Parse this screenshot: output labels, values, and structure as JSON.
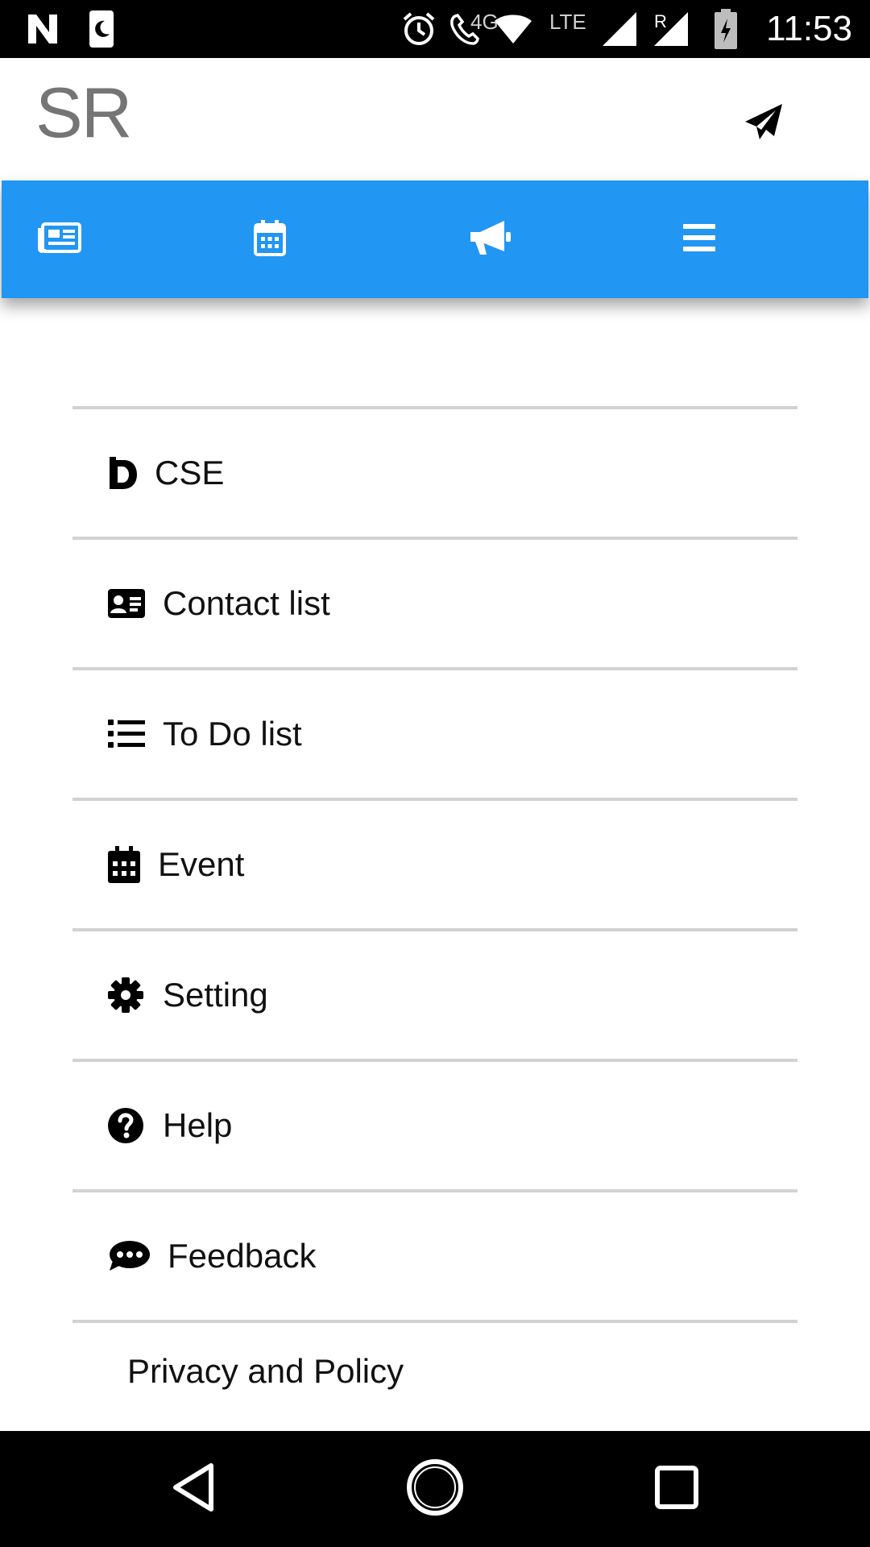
{
  "status_bar": {
    "time": "11:53",
    "network_4g": "4G",
    "network_lte": "LTE",
    "roaming": "R",
    "icons": [
      "notification-n-icon",
      "sim-moon-icon",
      "alarm-icon",
      "call-4g-icon",
      "wifi-icon",
      "signal-icon",
      "signal-roaming-icon",
      "battery-charging-icon"
    ]
  },
  "header": {
    "title": "SR",
    "send_icon": "paper-plane-icon"
  },
  "tabs": [
    {
      "icon": "newspaper-icon"
    },
    {
      "icon": "calendar-icon"
    },
    {
      "icon": "megaphone-icon"
    },
    {
      "icon": "menu-icon"
    }
  ],
  "menu": {
    "items": [
      {
        "label": "CSE",
        "icon": "cse-logo-icon"
      },
      {
        "label": "Contact list",
        "icon": "id-card-icon"
      },
      {
        "label": "To Do list",
        "icon": "list-icon"
      },
      {
        "label": "Event",
        "icon": "calendar-icon"
      },
      {
        "label": "Setting",
        "icon": "gear-icon"
      },
      {
        "label": "Help",
        "icon": "question-icon"
      },
      {
        "label": "Feedback",
        "icon": "comment-dots-icon"
      }
    ],
    "privacy_label": "Privacy and Policy"
  },
  "colors": {
    "accent": "#2196F3",
    "title_gray": "#757575",
    "divider": "#d2d2d2"
  },
  "nav": {
    "back_icon": "back-triangle-icon",
    "home_icon": "home-circle-icon",
    "recents_icon": "recents-square-icon"
  }
}
